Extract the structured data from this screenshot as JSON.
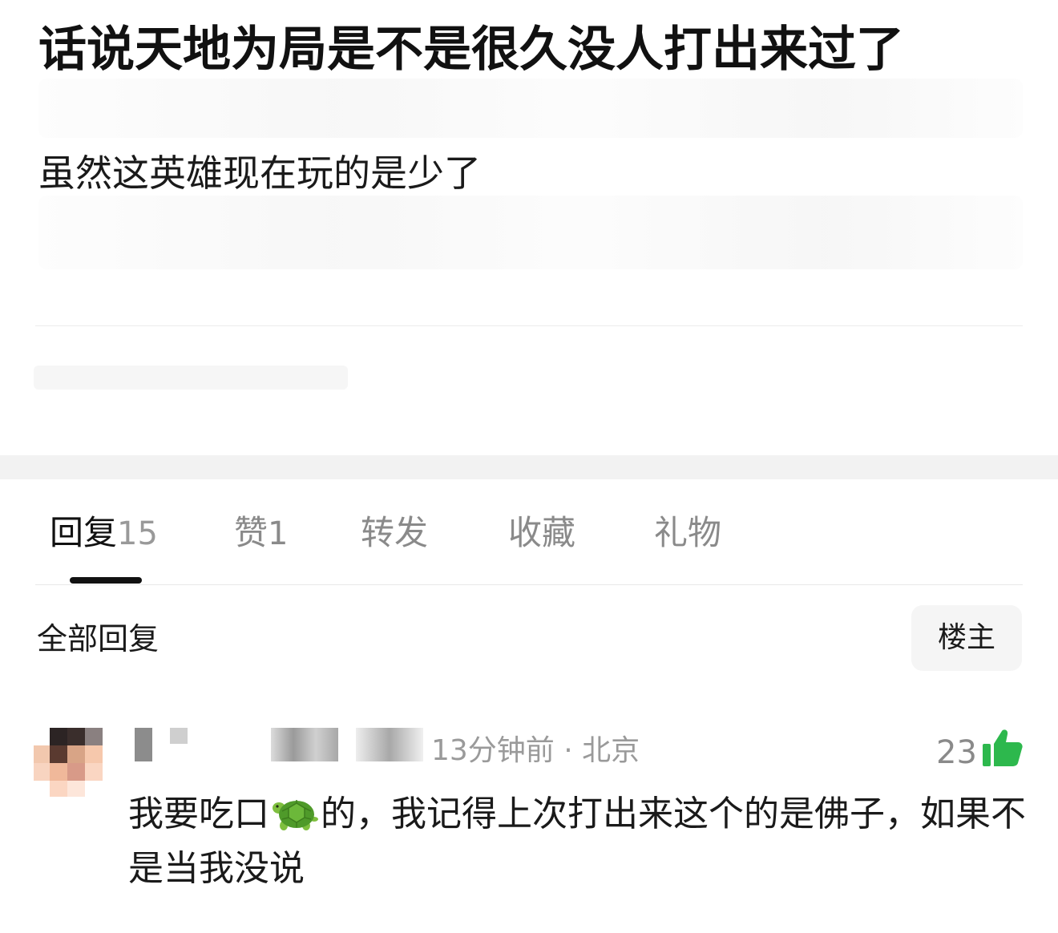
{
  "post": {
    "title": "话说天地为局是不是很久没人打出来过了",
    "body": "虽然这英雄现在玩的是少了"
  },
  "tabs": [
    {
      "label": "回复",
      "count": "15"
    },
    {
      "label": "赞",
      "count": "1"
    },
    {
      "label": "转发",
      "count": ""
    },
    {
      "label": "收藏",
      "count": ""
    },
    {
      "label": "礼物",
      "count": ""
    }
  ],
  "replies": {
    "filter_label": "全部回复",
    "op_filter_label": "楼主"
  },
  "comment": {
    "meta": "13分钟前 · 北京",
    "likes": "23",
    "body_before_icon": "我要吃口",
    "body_after_icon": "的，我记得上次打出来这个的是佛子，如果不是当我没说"
  },
  "icons": {
    "inline_emoji": "turtle-emoji",
    "like": "thumbs-up-icon"
  },
  "colors": {
    "like_icon": "#2db84d",
    "active_tab": "#111111",
    "inactive_tab": "#8a8a8a",
    "section_gap": "#f2f2f2"
  }
}
